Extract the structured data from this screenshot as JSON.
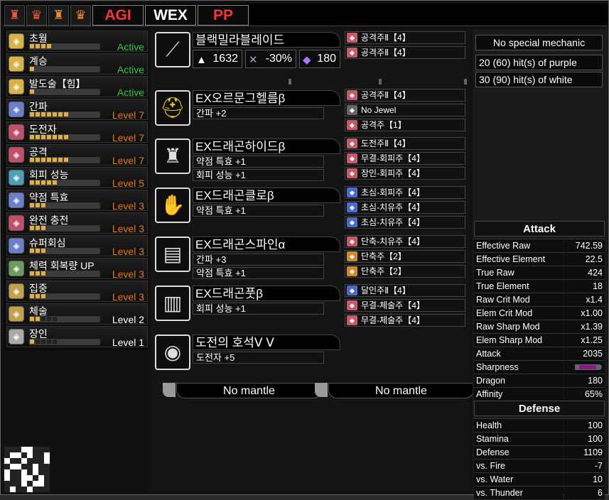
{
  "topbar": {
    "icons": [
      "bottle-icon",
      "crown-icon",
      "bottle2-icon",
      "crown2-icon"
    ],
    "buttons": [
      "AGI",
      "WEX",
      "PP"
    ]
  },
  "skills": [
    {
      "name": "초월",
      "level": "Active",
      "color": "#36c83a",
      "pips": 4,
      "max": 4
    },
    {
      "name": "계승",
      "level": "Active",
      "color": "#36c83a",
      "pips": 1,
      "max": 1
    },
    {
      "name": "발도술【힘】",
      "level": "Active",
      "color": "#36c83a",
      "pips": 1,
      "max": 1
    },
    {
      "name": "간파",
      "level": "Level 7",
      "color": "#e07a1c",
      "pips": 7,
      "max": 7
    },
    {
      "name": "도전자",
      "level": "Level 7",
      "color": "#e07a1c",
      "pips": 7,
      "max": 7
    },
    {
      "name": "공격",
      "level": "Level 7",
      "color": "#e07a1c",
      "pips": 7,
      "max": 7
    },
    {
      "name": "회피 성능",
      "level": "Level 5",
      "color": "#e07a1c",
      "pips": 5,
      "max": 5
    },
    {
      "name": "약점 특효",
      "level": "Level 3",
      "color": "#e07a1c",
      "pips": 3,
      "max": 3
    },
    {
      "name": "완전 충전",
      "level": "Level 3",
      "color": "#e07a1c",
      "pips": 3,
      "max": 3
    },
    {
      "name": "슈퍼회심",
      "level": "Level 3",
      "color": "#e07a1c",
      "pips": 3,
      "max": 3
    },
    {
      "name": "체력 회복량 UP",
      "level": "Level 3",
      "color": "#e07a1c",
      "pips": 3,
      "max": 3
    },
    {
      "name": "집중",
      "level": "Level 3",
      "color": "#e07a1c",
      "pips": 3,
      "max": 3
    },
    {
      "name": "체술",
      "level": "Level 2",
      "color": "#ffffff",
      "pips": 2,
      "max": 5
    },
    {
      "name": "장인",
      "level": "Level 1",
      "color": "#ffffff",
      "pips": 1,
      "max": 5
    }
  ],
  "weapon": {
    "name": "블랙밀라블레이드",
    "attack": "1632",
    "affinity": "-30%",
    "element": "180"
  },
  "armor": [
    {
      "name": "EX오르문그헬름β",
      "skills": [
        "간파 +2"
      ]
    },
    {
      "name": "EX드래곤하이드β",
      "skills": [
        "약점 특효 +1",
        "회피 성능 +1"
      ]
    },
    {
      "name": "EX드래곤클로β",
      "skills": [
        "약점 특효 +1"
      ]
    },
    {
      "name": "EX드래곤스파인α",
      "skills": [
        "간파 +3",
        "약점 특효 +1"
      ]
    },
    {
      "name": "EX드래곤풋β",
      "skills": [
        "회피 성능 +1"
      ]
    },
    {
      "name": "도전의 호석Ⅴ Ⅴ",
      "skills": [
        "도전자 +5"
      ]
    }
  ],
  "decorations": [
    [
      "공격주Ⅱ【4】",
      "공격주Ⅱ【4】"
    ],
    [
      "공격주Ⅱ【4】",
      "No Jewel",
      "공격주【1】"
    ],
    [
      "도전주Ⅱ【4】",
      "무결-회피주【4】",
      "장인-회피주【4】"
    ],
    [
      "초심-회피주【4】",
      "초심-치유주【4】",
      "초심-치유주【4】"
    ],
    [
      "단축-치유주【4】",
      "단축주【2】",
      "단축주【2】"
    ],
    [
      "달인주Ⅱ【4】",
      "무결-체술주【4】",
      "무결-체술주【4】"
    ]
  ],
  "mantles": [
    "No mantle",
    "No mantle"
  ],
  "info": [
    "No special mechanic",
    "20 (60) hit(s) of purple",
    "30 (90) hit(s) of white"
  ],
  "attack_section": {
    "title": "Attack",
    "rows": [
      {
        "k": "Effective Raw",
        "v": "742.59"
      },
      {
        "k": "Effective Element",
        "v": "22.5"
      },
      {
        "k": "True Raw",
        "v": "424"
      },
      {
        "k": "True Element",
        "v": "18"
      },
      {
        "k": "Raw Crit Mod",
        "v": "x1.4"
      },
      {
        "k": "Elem Crit Mod",
        "v": "x1.00"
      },
      {
        "k": "Raw Sharp Mod",
        "v": "x1.39"
      },
      {
        "k": "Elem Sharp Mod",
        "v": "x1.25"
      },
      {
        "k": "Attack",
        "v": "2035"
      },
      {
        "k": "Sharpness",
        "v": ""
      },
      {
        "k": "Dragon",
        "v": "180"
      },
      {
        "k": "Affinity",
        "v": "65%"
      }
    ]
  },
  "defense_section": {
    "title": "Defense",
    "rows": [
      {
        "k": "Health",
        "v": "100"
      },
      {
        "k": "Stamina",
        "v": "100"
      },
      {
        "k": "Defense",
        "v": "1109"
      },
      {
        "k": "vs. Fire",
        "v": "-7"
      },
      {
        "k": "vs. Water",
        "v": "10"
      },
      {
        "k": "vs. Thunder",
        "v": "6"
      }
    ]
  }
}
